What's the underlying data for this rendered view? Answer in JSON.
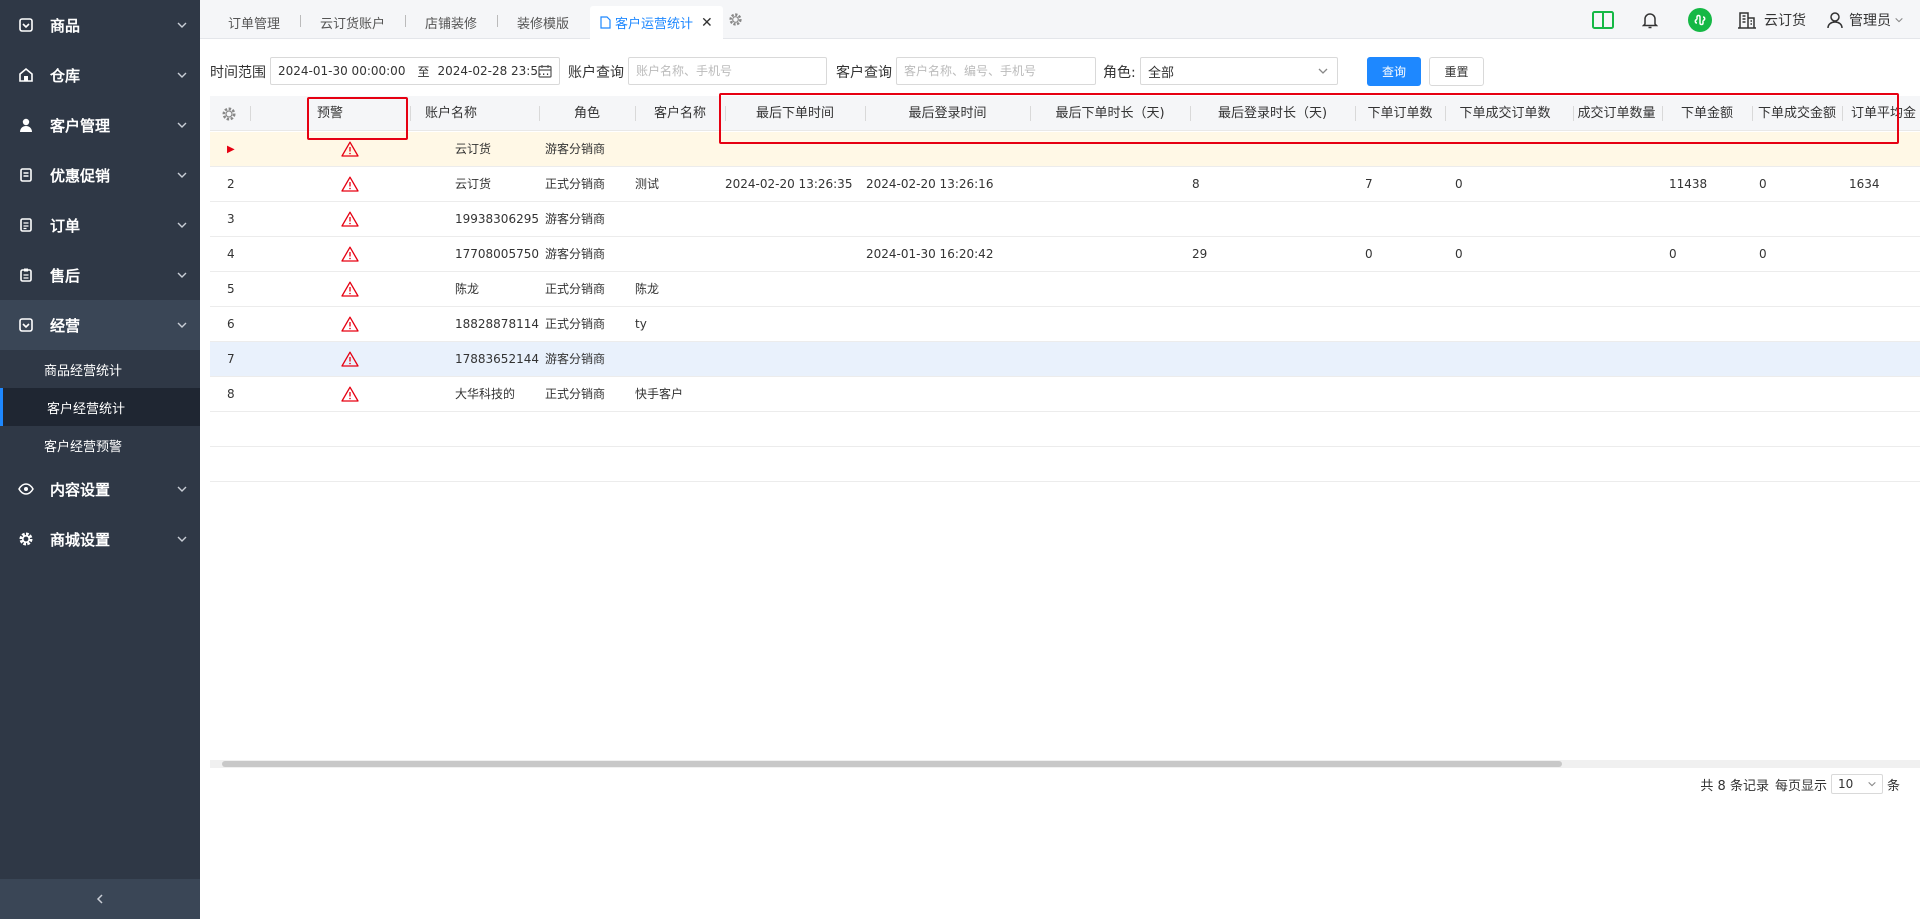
{
  "sidebar": {
    "items": [
      {
        "label": "商品",
        "icon": "goods-icon"
      },
      {
        "label": "仓库",
        "icon": "warehouse-icon"
      },
      {
        "label": "客户管理",
        "icon": "user-icon"
      },
      {
        "label": "优惠促销",
        "icon": "promo-icon"
      },
      {
        "label": "订单",
        "icon": "order-icon"
      },
      {
        "label": "售后",
        "icon": "aftersale-icon"
      },
      {
        "label": "经营",
        "icon": "business-icon"
      },
      {
        "label": "内容设置",
        "icon": "eye-icon"
      },
      {
        "label": "商城设置",
        "icon": "gear-icon"
      }
    ],
    "sub_items": [
      {
        "label": "商品经营统计"
      },
      {
        "label": "客户经营统计"
      },
      {
        "label": "客户经营预警"
      }
    ]
  },
  "tabs": [
    {
      "label": "订单管理"
    },
    {
      "label": "云订货账户"
    },
    {
      "label": "店铺装修"
    },
    {
      "label": "装修模版"
    },
    {
      "label": "客户运营统计",
      "close": "✕"
    }
  ],
  "topbar": {
    "company": "云订货",
    "user": "管理员"
  },
  "filters": {
    "time_label": "时间范围",
    "date_start": "2024-01-30 00:00:00",
    "date_sep": "至",
    "date_end": "2024-02-28 23:5...",
    "account_label": "账户查询",
    "account_placeholder": "账户名称、手机号",
    "customer_label": "客户查询",
    "customer_placeholder": "客户名称、编号、手机号",
    "role_label": "角色:",
    "role_value": "全部",
    "query_button": "查询",
    "reset_button": "重置"
  },
  "table": {
    "columns": [
      "预警",
      "账户名称",
      "角色",
      "客户名称",
      "最后下单时间",
      "最后登录时间",
      "最后下单时长（天)",
      "最后登录时长（天)",
      "下单订单数",
      "下单成交订单数",
      "成交订单数量",
      "下单金额",
      "下单成交金额",
      "订单平均金"
    ],
    "rows": [
      {
        "no": "▶",
        "account": "云订货",
        "role": "游客分销商",
        "customer": "",
        "last_order": "",
        "last_login": "",
        "order_days": "",
        "login_days": "",
        "orders": "",
        "deal_orders": "",
        "deal_qty": "",
        "amount": "",
        "deal_amount": "",
        "avg": ""
      },
      {
        "no": "2",
        "account": "云订货",
        "role": "正式分销商",
        "customer": "测试",
        "last_order": "2024-02-20 13:26:35",
        "last_login": "2024-02-20 13:26:16",
        "order_days": "",
        "login_days": "8",
        "orders": "7",
        "deal_orders": "0",
        "deal_qty": "",
        "amount": "11438",
        "deal_amount": "0",
        "avg": "1634"
      },
      {
        "no": "3",
        "account": "19938306295",
        "role": "游客分销商",
        "customer": "",
        "last_order": "",
        "last_login": "",
        "order_days": "",
        "login_days": "",
        "orders": "",
        "deal_orders": "",
        "deal_qty": "",
        "amount": "",
        "deal_amount": "",
        "avg": ""
      },
      {
        "no": "4",
        "account": "17708005750",
        "role": "游客分销商",
        "customer": "",
        "last_order": "",
        "last_login": "2024-01-30 16:20:42",
        "order_days": "",
        "login_days": "29",
        "orders": "0",
        "deal_orders": "0",
        "deal_qty": "",
        "amount": "0",
        "deal_amount": "0",
        "avg": ""
      },
      {
        "no": "5",
        "account": "陈龙",
        "role": "正式分销商",
        "customer": "陈龙",
        "last_order": "",
        "last_login": "",
        "order_days": "",
        "login_days": "",
        "orders": "",
        "deal_orders": "",
        "deal_qty": "",
        "amount": "",
        "deal_amount": "",
        "avg": ""
      },
      {
        "no": "6",
        "account": "18828878114",
        "role": "正式分销商",
        "customer": "ty",
        "last_order": "",
        "last_login": "",
        "order_days": "",
        "login_days": "",
        "orders": "",
        "deal_orders": "",
        "deal_qty": "",
        "amount": "",
        "deal_amount": "",
        "avg": ""
      },
      {
        "no": "7",
        "account": "17883652144",
        "role": "游客分销商",
        "customer": "",
        "last_order": "",
        "last_login": "",
        "order_days": "",
        "login_days": "",
        "orders": "",
        "deal_orders": "",
        "deal_qty": "",
        "amount": "",
        "deal_amount": "",
        "avg": ""
      },
      {
        "no": "8",
        "account": "大华科技的",
        "role": "正式分销商",
        "customer": "快手客户",
        "last_order": "",
        "last_login": "",
        "order_days": "",
        "login_days": "",
        "orders": "",
        "deal_orders": "",
        "deal_qty": "",
        "amount": "",
        "deal_amount": "",
        "avg": ""
      }
    ]
  },
  "pager": {
    "total": "共 8 条记录",
    "per_page_label": "每页显示",
    "per_page": "10",
    "unit": "条"
  },
  "colors": {
    "accent": "#1e88ff",
    "sidebar_bg": "#2f3846",
    "warning": "#e60012",
    "green": "#15b845"
  }
}
